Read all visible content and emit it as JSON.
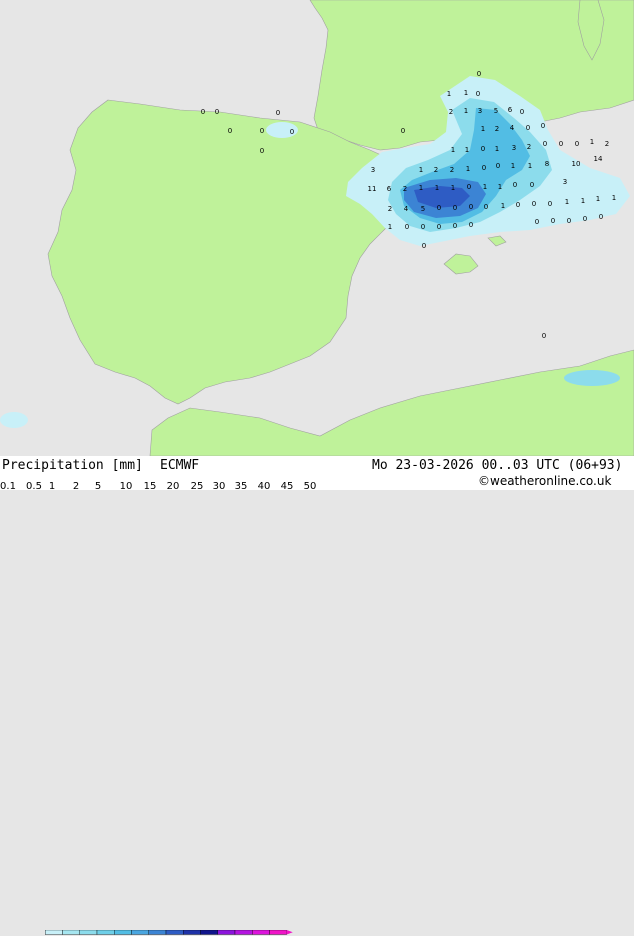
{
  "map": {
    "value_labels": [
      "0",
      "1",
      "1",
      "0",
      "0",
      "0",
      "0",
      "0",
      "0",
      "0",
      "2",
      "1",
      "3",
      "5",
      "6",
      "0",
      "1",
      "2",
      "4",
      "0",
      "0",
      "0",
      "1",
      "1",
      "0",
      "1",
      "3",
      "2",
      "0",
      "0",
      "0",
      "1",
      "2",
      "3",
      "1",
      "2",
      "2",
      "1",
      "0",
      "0",
      "1",
      "1",
      "8",
      "10",
      "14",
      "11",
      "6",
      "2",
      "1",
      "1",
      "1",
      "0",
      "1",
      "1",
      "0",
      "0",
      "3",
      "2",
      "4",
      "5",
      "0",
      "0",
      "0",
      "0",
      "1",
      "0",
      "0",
      "0",
      "1",
      "1",
      "1",
      "1",
      "1",
      "0",
      "0",
      "0",
      "0",
      "0",
      "0",
      "0",
      "0",
      "0",
      "0",
      "0",
      "0",
      "0"
    ]
  },
  "footer": {
    "title": "Precipitation [mm]",
    "model": "ECMWF",
    "datetime": "Mo 23-03-2026 00..03 UTC (06+93)",
    "credit": "©weatheronline.co.uk"
  },
  "legend": {
    "ticks": [
      "0.1",
      "0.5",
      "1",
      "2",
      "5",
      "10",
      "15",
      "20",
      "25",
      "30",
      "35",
      "40",
      "45",
      "50"
    ],
    "colors": [
      "#c8f0f8",
      "#a6e6f0",
      "#8cdcec",
      "#6ecfe8",
      "#52bde4",
      "#4aa6e0",
      "#3c84d4",
      "#2e5cc4",
      "#1e32a8",
      "#10148c",
      "#8c14dc",
      "#b414e0",
      "#dc14dc",
      "#f014c8"
    ],
    "land_color": "#bff29a",
    "sea_color": "#e6e6e6"
  }
}
